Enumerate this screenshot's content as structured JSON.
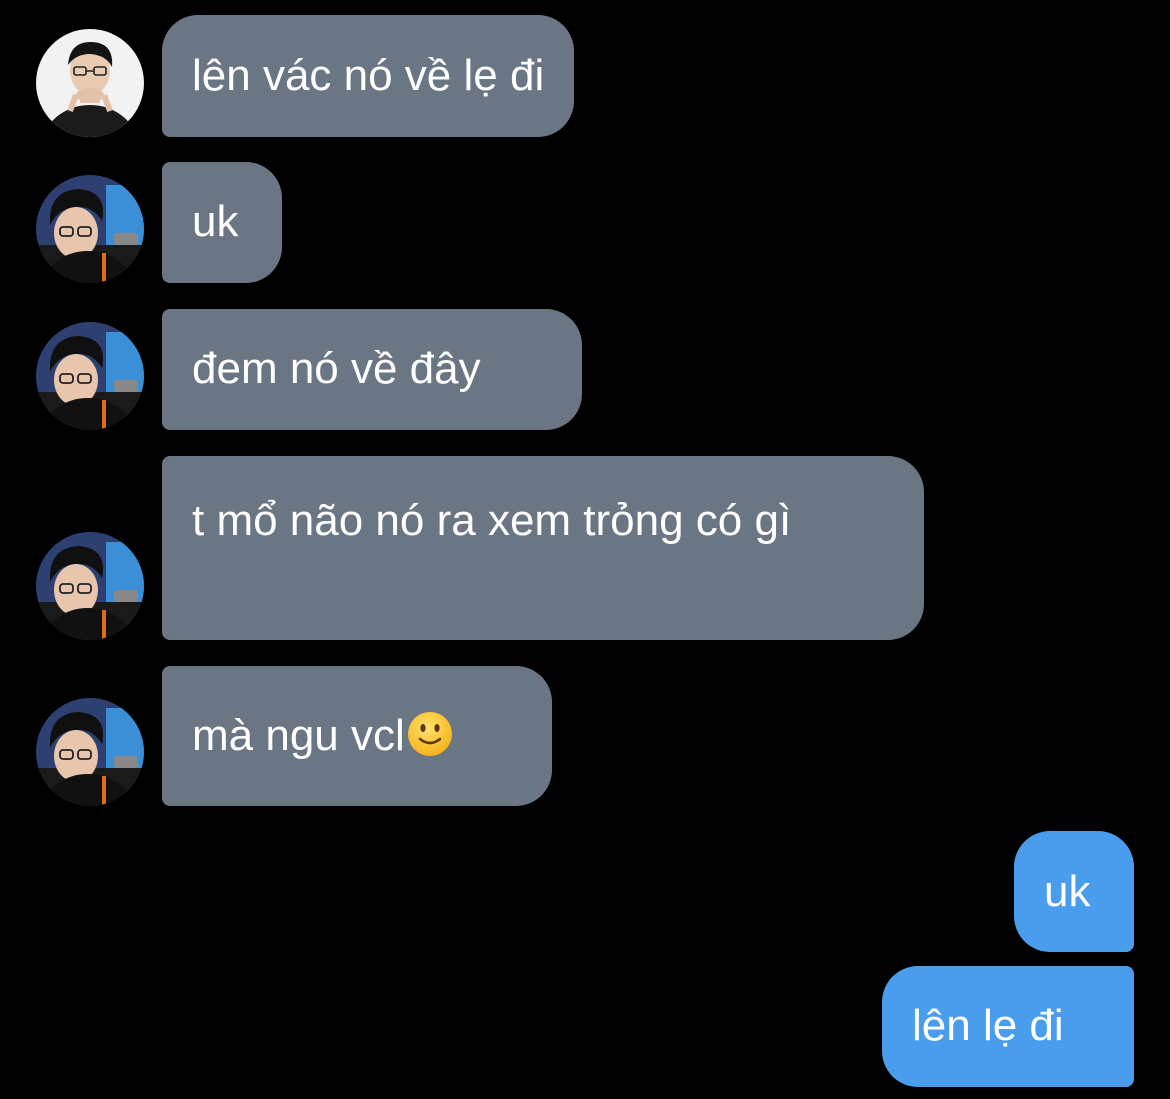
{
  "conversation": {
    "messages": [
      {
        "from": "contact",
        "text": "lên vác nó về lẹ đi",
        "avatar": "avatar-contact-white-shirt"
      },
      {
        "from": "contact",
        "text": "uk",
        "avatar": "avatar-contact-glasses"
      },
      {
        "from": "contact",
        "text": "đem nó về đây",
        "avatar": "avatar-contact-glasses"
      },
      {
        "from": "contact",
        "text": "t mổ não nó ra xem trỏng có gì",
        "avatar": "avatar-contact-glasses"
      },
      {
        "from": "contact",
        "text": "mà ngu vcl",
        "emoji": "slightly-smiling-face",
        "avatar": "avatar-contact-glasses"
      },
      {
        "from": "me",
        "text": "uk"
      },
      {
        "from": "me",
        "text": "lên lẹ đi"
      }
    ]
  },
  "colors": {
    "background": "#000000",
    "incoming_bubble": "#6b7684",
    "outgoing_bubble": "#4a9ded",
    "text": "#ffffff"
  }
}
